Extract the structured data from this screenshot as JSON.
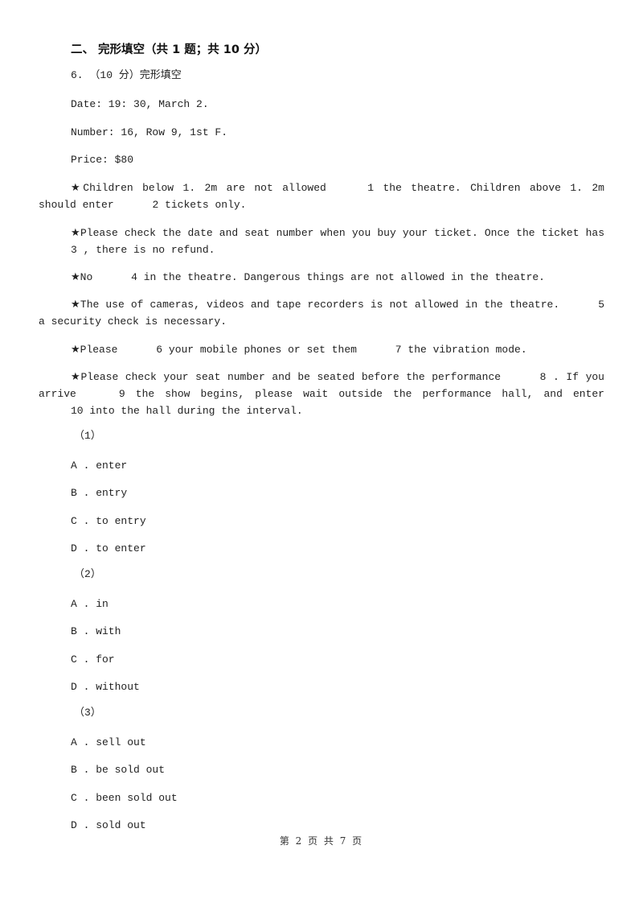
{
  "section": {
    "title": "二、  完形填空（共 1 题；共 10 分）"
  },
  "question": {
    "header": "6. （10 分）完形填空",
    "ticket": {
      "date": "Date: 19: 30, March 2.",
      "number": "Number: 16, Row 9, 1st F.",
      "price": "Price: $80"
    },
    "rules": [
      {
        "star": "★",
        "parts": [
          "Children below 1. 2m are not allowed",
          "1",
          "the theatre. Children above  1. 2m should enter",
          "2",
          "tickets only."
        ]
      },
      {
        "star": "★",
        "parts": [
          "Please check the date and seat number when you buy your ticket. Once the ticket has",
          "3",
          ", there is no refund."
        ]
      },
      {
        "star": "★",
        "parts": [
          "No",
          "4",
          "in the theatre. Dangerous things are not allowed in the theatre."
        ]
      },
      {
        "star": "★",
        "parts": [
          "The use of cameras, videos and tape recorders is not allowed in the theatre.",
          "5",
          "a security check is necessary."
        ]
      },
      {
        "star": "★",
        "parts": [
          "Please",
          "6",
          "your mobile phones or set them",
          "7",
          "the vibration mode."
        ]
      },
      {
        "star": "★",
        "parts": [
          "Please check your seat number and be seated before the performance",
          "8",
          ". If you arrive",
          "9",
          "the show begins, please wait outside the performance hall, and enter",
          "10",
          "into the hall during the interval."
        ]
      }
    ],
    "subquestions": [
      {
        "label": "（1）",
        "options": [
          "A . enter",
          "B . entry",
          "C . to entry",
          "D . to enter"
        ]
      },
      {
        "label": "（2）",
        "options": [
          "A . in",
          "B . with",
          "C . for",
          "D . without"
        ]
      },
      {
        "label": "（3）",
        "options": [
          "A . sell out",
          "B . be sold out",
          "C . been sold out",
          "D . sold out"
        ]
      }
    ]
  },
  "footer": {
    "page_info": "第 2 页 共 7 页"
  }
}
